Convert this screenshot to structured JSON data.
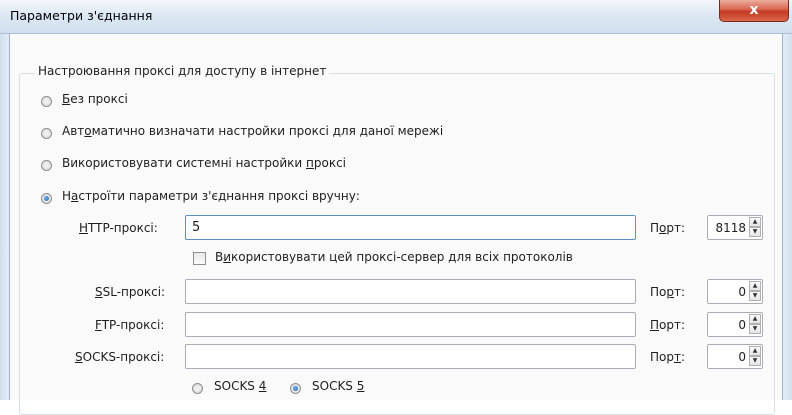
{
  "window": {
    "title": "Параметри з'єднання",
    "close_label": "x"
  },
  "proxy": {
    "group_title": "Настроювання проксі для доступу в інтернет",
    "options": [
      {
        "label_pre": "",
        "label_key": "Б",
        "label_post": "ез проксі",
        "checked": false
      },
      {
        "label_pre": "Авт",
        "label_key": "о",
        "label_post": "матично визначати настройки проксі для даної мережі",
        "checked": false
      },
      {
        "label_pre": "Використовувати системні настройки ",
        "label_key": "п",
        "label_post": "роксі",
        "checked": false
      },
      {
        "label_pre": "Н",
        "label_key": "а",
        "label_post": "строїти параметри з'єднання проксі вручну:",
        "checked": true
      }
    ],
    "http": {
      "label_key": "H",
      "label_post": "TTP-проксі:",
      "value": "5",
      "port_label_pre": "П",
      "port_label_key": "о",
      "port_label_post": "рт:",
      "port": "8118"
    },
    "use_for_all": {
      "label_pre": "В",
      "label_key": "и",
      "label_post": "користовувати цей проксі-сервер для всіх протоколів",
      "checked": false
    },
    "ssl": {
      "label_key": "S",
      "label_post": "SL-проксі:",
      "value": "",
      "port_label_pre": "По",
      "port_label_key": "р",
      "port_label_post": "т:",
      "port": "0"
    },
    "ftp": {
      "label_key": "F",
      "label_post": "TP-проксі:",
      "value": "",
      "port_label_pre": "",
      "port_label_key": "П",
      "port_label_post": "орт:",
      "port": "0"
    },
    "socks": {
      "label_key": "S",
      "label_post": "OCKS-проксі:",
      "value": "",
      "port_label_pre": "Пор",
      "port_label_key": "т",
      "port_label_post": ":",
      "port": "0"
    },
    "socks_versions": [
      {
        "label_pre": "SOCKS ",
        "label_key": "4",
        "checked": false
      },
      {
        "label_pre": "SOCKS ",
        "label_key": "5",
        "checked": true
      }
    ]
  }
}
